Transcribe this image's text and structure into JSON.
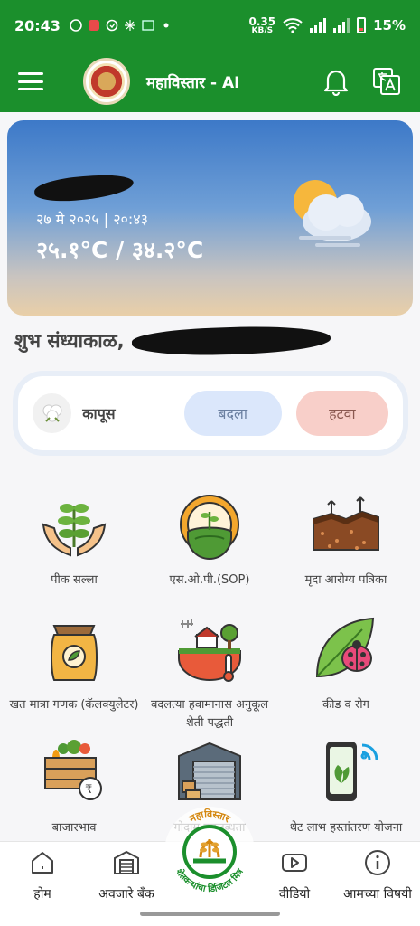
{
  "status_bar": {
    "time": "20:43",
    "net_speed_top": "0.35",
    "net_speed_bottom": "KB/S",
    "battery": "15%"
  },
  "app_bar": {
    "title": "महाविस्तार - AI"
  },
  "weather": {
    "date": "२७ मे २०२५ | २०:४३",
    "temperature": "२५.१°C / ३४.२°C"
  },
  "greeting": "शुभ संध्याकाळ,",
  "crop": {
    "name": "कापूस",
    "change_label": "बदला",
    "remove_label": "हटवा"
  },
  "menu": [
    {
      "label": "पीक सल्ला",
      "icon": "hands-plant-icon"
    },
    {
      "label": "एस.ओ.पी.(SOP)",
      "icon": "gear-farm-icon"
    },
    {
      "label": "मृदा आरोग्य पत्रिका",
      "icon": "soil-layer-icon"
    },
    {
      "label": "खत मात्रा गणक (कॅलक्युलेटर)",
      "icon": "fertilizer-sack-icon"
    },
    {
      "label": "बदलत्या हवामानास अनुकूल शेती पद्धती",
      "icon": "climate-farm-icon"
    },
    {
      "label": "कीड व रोग",
      "icon": "ladybug-leaf-icon"
    },
    {
      "label": "बाजारभाव",
      "icon": "market-crate-icon"
    },
    {
      "label": "गोदाम उपलब्धता",
      "icon": "warehouse-icon"
    },
    {
      "label": "थेट लाभ हस्तांतरण योजना",
      "icon": "phone-transfer-icon"
    }
  ],
  "badge_text": {
    "top": "महाविस्तार",
    "bottom": "शेतकऱ्यांचा डिजिटल मित्र"
  },
  "bottom_nav": [
    {
      "label": "होम",
      "icon": "home-icon"
    },
    {
      "label": "अवजारे बँक",
      "icon": "warehouse-bank-icon"
    },
    {
      "label": "वीडियो",
      "icon": "video-icon"
    },
    {
      "label": "आमच्या विषयी",
      "icon": "info-icon"
    }
  ]
}
